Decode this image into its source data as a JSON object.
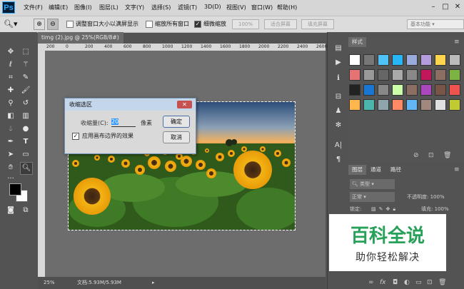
{
  "menubar": {
    "logo": "Ps",
    "items": [
      "文件(F)",
      "编辑(E)",
      "图像(I)",
      "图层(L)",
      "文字(Y)",
      "选择(S)",
      "滤镜(T)",
      "3D(D)",
      "视图(V)",
      "窗口(W)",
      "帮助(H)"
    ],
    "controls": [
      "–",
      "□",
      "✕"
    ]
  },
  "options": {
    "resize_windows": "调整窗口大小以满屏显示",
    "zoom_all": "缩放所有窗口",
    "scrubby_zoom": "细微缩放",
    "pct": "100%",
    "fit_screen": "适合屏幕",
    "fill_screen": "填充屏幕",
    "workspace": "基本功能"
  },
  "document": {
    "tab_label": "timg (2).jpg @ 25%(RGB/8#)",
    "tab_close": "×",
    "zoom_level": "25%",
    "doc_info": "文档:5.93M/5.93M",
    "ruler_ticks": [
      "200",
      "0",
      "200",
      "400",
      "600",
      "800",
      "1000",
      "1200",
      "1400",
      "1600",
      "1800",
      "2000",
      "2200",
      "2400",
      "2600"
    ]
  },
  "dialog": {
    "title": "收缩选区",
    "close": "✕",
    "amount_label": "收缩量(C):",
    "amount_value": "20",
    "unit": "像素",
    "apply_edge_label": "应用画布边界的效果",
    "apply_edge_checked": "✓",
    "ok": "确定",
    "cancel": "取消"
  },
  "panels": {
    "styles_tab": "样式",
    "layers_tabs": [
      "图层",
      "通道",
      "路径"
    ],
    "kind_label": "类型",
    "blend_mode": "正常",
    "opacity_label": "不透明度:",
    "opacity_value": "100%",
    "lock_label": "锁定:",
    "fill_label": "填充:",
    "fill_value": "100%"
  },
  "watermark": {
    "line1": "百科全说",
    "line2": "助你轻松解决"
  },
  "colors": {
    "accent": "#31a8ff",
    "watermark_green": "#27a05a",
    "dialog_title_bg": "#c4d6ea"
  },
  "icons": [
    "zoom-tool-icon",
    "move-tool-icon",
    "marquee-tool-icon",
    "lasso-tool-icon",
    "magic-wand-icon",
    "crop-tool-icon",
    "eyedropper-icon",
    "healing-brush-icon",
    "brush-icon",
    "clone-stamp-icon",
    "history-brush-icon",
    "eraser-icon",
    "gradient-icon",
    "blur-icon",
    "dodge-icon",
    "pen-icon",
    "type-icon",
    "path-select-icon",
    "shape-icon",
    "hand-icon",
    "zoom-icon",
    "more-tools-icon"
  ]
}
